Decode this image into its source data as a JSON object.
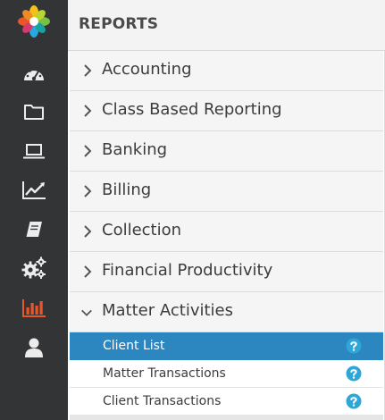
{
  "colors": {
    "sidebar_bg": "#333436",
    "sidebar_icon": "#ececec",
    "sidebar_active_icon": "#e8562a",
    "selected_row_bg": "#2c86bf",
    "help_icon": "#2ea7d8"
  },
  "sidebar": {
    "logo_icon": "flower-logo",
    "items": [
      {
        "icon": "dashboard-gauge-icon",
        "active": false
      },
      {
        "icon": "folder-icon",
        "active": false
      },
      {
        "icon": "laptop-icon",
        "active": false
      },
      {
        "icon": "line-chart-icon",
        "active": false
      },
      {
        "icon": "book-icon",
        "active": false
      },
      {
        "icon": "gears-icon",
        "active": false
      },
      {
        "icon": "bar-chart-icon",
        "active": true
      },
      {
        "icon": "user-icon",
        "active": false
      }
    ]
  },
  "panel": {
    "title": "REPORTS",
    "categories": [
      {
        "label": "Accounting",
        "expanded": false
      },
      {
        "label": "Class Based Reporting",
        "expanded": false
      },
      {
        "label": "Banking",
        "expanded": false
      },
      {
        "label": "Billing",
        "expanded": false
      },
      {
        "label": "Collection",
        "expanded": false
      },
      {
        "label": "Financial Productivity",
        "expanded": false
      },
      {
        "label": "Matter Activities",
        "expanded": true
      }
    ],
    "subitems": [
      {
        "label": "Client List",
        "selected": true
      },
      {
        "label": "Matter Transactions",
        "selected": false
      },
      {
        "label": "Client Transactions",
        "selected": false
      }
    ]
  }
}
